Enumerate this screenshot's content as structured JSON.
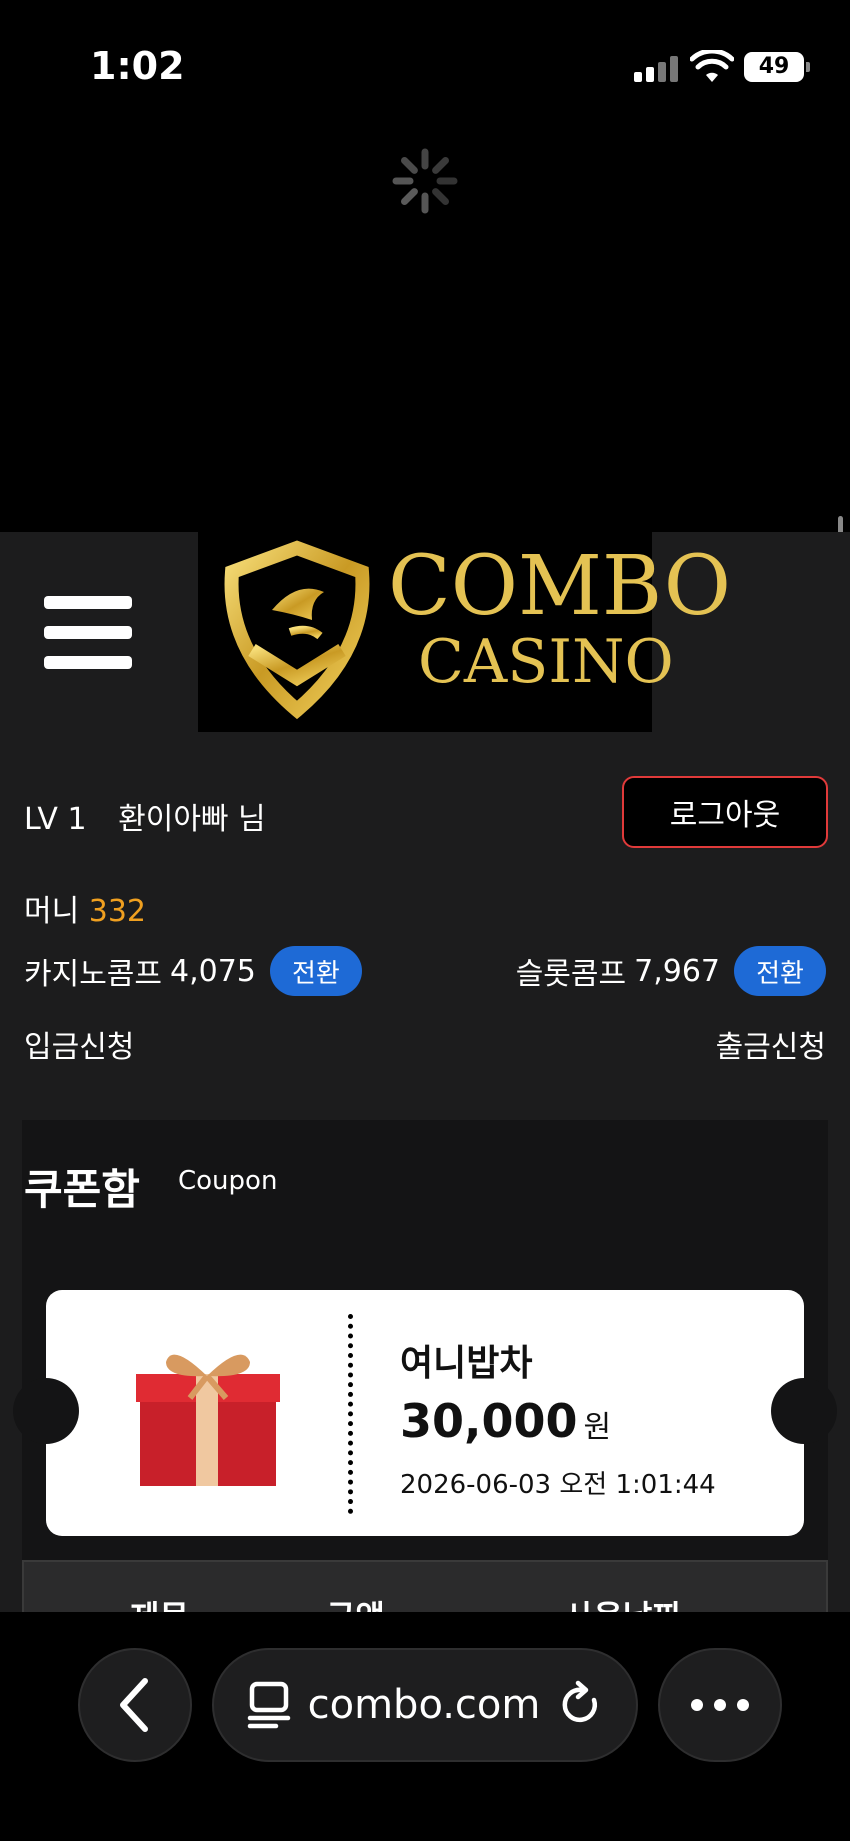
{
  "status_bar": {
    "time": "1:02",
    "battery": "49"
  },
  "header": {
    "logo_line1": "COMBO",
    "logo_line2": "CASINO"
  },
  "user": {
    "level": "LV 1",
    "name": "환이아빠 님",
    "logout_label": "로그아웃"
  },
  "money": {
    "label": "머니",
    "value": "332"
  },
  "comps": {
    "casino_label": "카지노콤프",
    "casino_value": "4,075",
    "slot_label": "슬롯콤프",
    "slot_value": "7,967",
    "convert_label": "전환"
  },
  "actions": {
    "deposit": "입금신청",
    "withdraw": "출금신청"
  },
  "coupon": {
    "title": "쿠폰함",
    "subtitle": "Coupon",
    "name": "여니밥차",
    "amount": "30,000",
    "unit": "원",
    "date": "2026-06-03 오전 1:01:44"
  },
  "table": {
    "headers": [
      "제목",
      "금액",
      "사용날짜"
    ]
  },
  "browser": {
    "url": "combo.com"
  }
}
